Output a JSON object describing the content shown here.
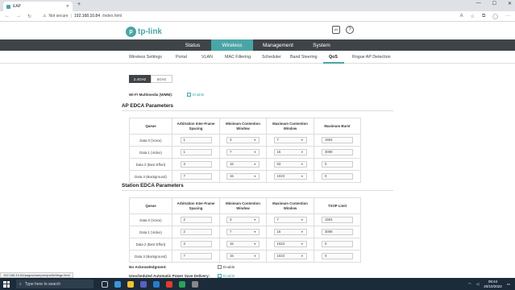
{
  "browser": {
    "tab_title": "EAP",
    "url_not_secure": "Not secure",
    "url_host": "192.168.10.84",
    "url_path": "/index.html",
    "status_url": "192.168.10.84/pages/userpm/qosSettings.html"
  },
  "header": {
    "logo_text": "tp-link",
    "main_nav": [
      "Status",
      "Wireless",
      "Management",
      "System"
    ],
    "active_main": "Wireless",
    "sub_nav": [
      "Wireless Settings",
      "Portal",
      "VLAN",
      "MAC Filtering",
      "Scheduler",
      "Band Steering",
      "QoS",
      "Rogue AP Detection"
    ],
    "active_sub": "QoS"
  },
  "band_tabs": [
    "2.4GHz",
    "5GHz"
  ],
  "active_band": "2.4GHz",
  "wmm": {
    "label": "Wi-Fi Multimedia (WMM):",
    "option": "Enable",
    "checked": true
  },
  "ap_edca": {
    "title": "AP EDCA Parameters",
    "headers": [
      "Queue",
      "Arbitration Inter-Frame Spacing",
      "Minimum Contention Window",
      "Maximum Contention Window",
      "Maximum Burst"
    ],
    "rows": [
      [
        "Data 0 (Voice)",
        "1",
        "3",
        "7",
        "1504"
      ],
      [
        "Data 1 (Video)",
        "1",
        "7",
        "15",
        "3008"
      ],
      [
        "Data 2 (Best Effort)",
        "3",
        "15",
        "63",
        "0"
      ],
      [
        "Data 3 (Background)",
        "7",
        "15",
        "1023",
        "0"
      ]
    ]
  },
  "station_edca": {
    "title": "Station EDCA Parameters",
    "headers": [
      "Queue",
      "Arbitration Inter-Frame Spacing",
      "Minimum Contention Window",
      "Maximum Contention Window",
      "TXOP Limit"
    ],
    "rows": [
      [
        "Data 0 (Voice)",
        "2",
        "3",
        "7",
        "1504"
      ],
      [
        "Data 1 (Video)",
        "2",
        "7",
        "15",
        "3008"
      ],
      [
        "Data 2 (Best Effort)",
        "3",
        "15",
        "1023",
        "0"
      ],
      [
        "Data 3 (Background)",
        "7",
        "15",
        "1023",
        "0"
      ]
    ]
  },
  "no_ack": {
    "label": "No Acknowledgment:",
    "option": "Enable",
    "checked": false
  },
  "apsd": {
    "label": "Unscheduled Automatic Power Save Delivery:",
    "option": "Enable",
    "checked": true
  },
  "taskbar": {
    "search_placeholder": "Type here to search",
    "time": "08:44",
    "date": "20/10/2022"
  },
  "colors": {
    "accent": "#4aa5a6",
    "nav_bg": "#3f4449",
    "taskbar_bg": "#1c2b3a"
  }
}
